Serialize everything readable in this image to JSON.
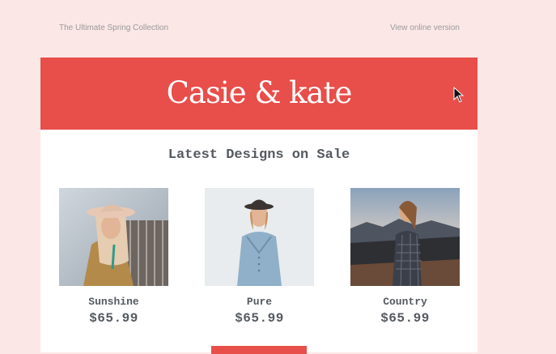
{
  "preheader": {
    "collection_text": "The Ultimate Spring Collection",
    "view_online": "View online version"
  },
  "banner": {
    "logo_text": "Casie & kate",
    "color": "#e84e4a"
  },
  "main": {
    "headline": "Latest Designs on Sale",
    "products": [
      {
        "name": "Sunshine",
        "price": "$65.99"
      },
      {
        "name": "Pure",
        "price": "$65.99"
      },
      {
        "name": "Country",
        "price": "$65.99"
      }
    ]
  },
  "colors": {
    "page_background": "#fce7e7",
    "accent": "#e84e4a",
    "text": "#555a60"
  },
  "icons": {
    "cursor": "mouse-pointer-icon"
  }
}
